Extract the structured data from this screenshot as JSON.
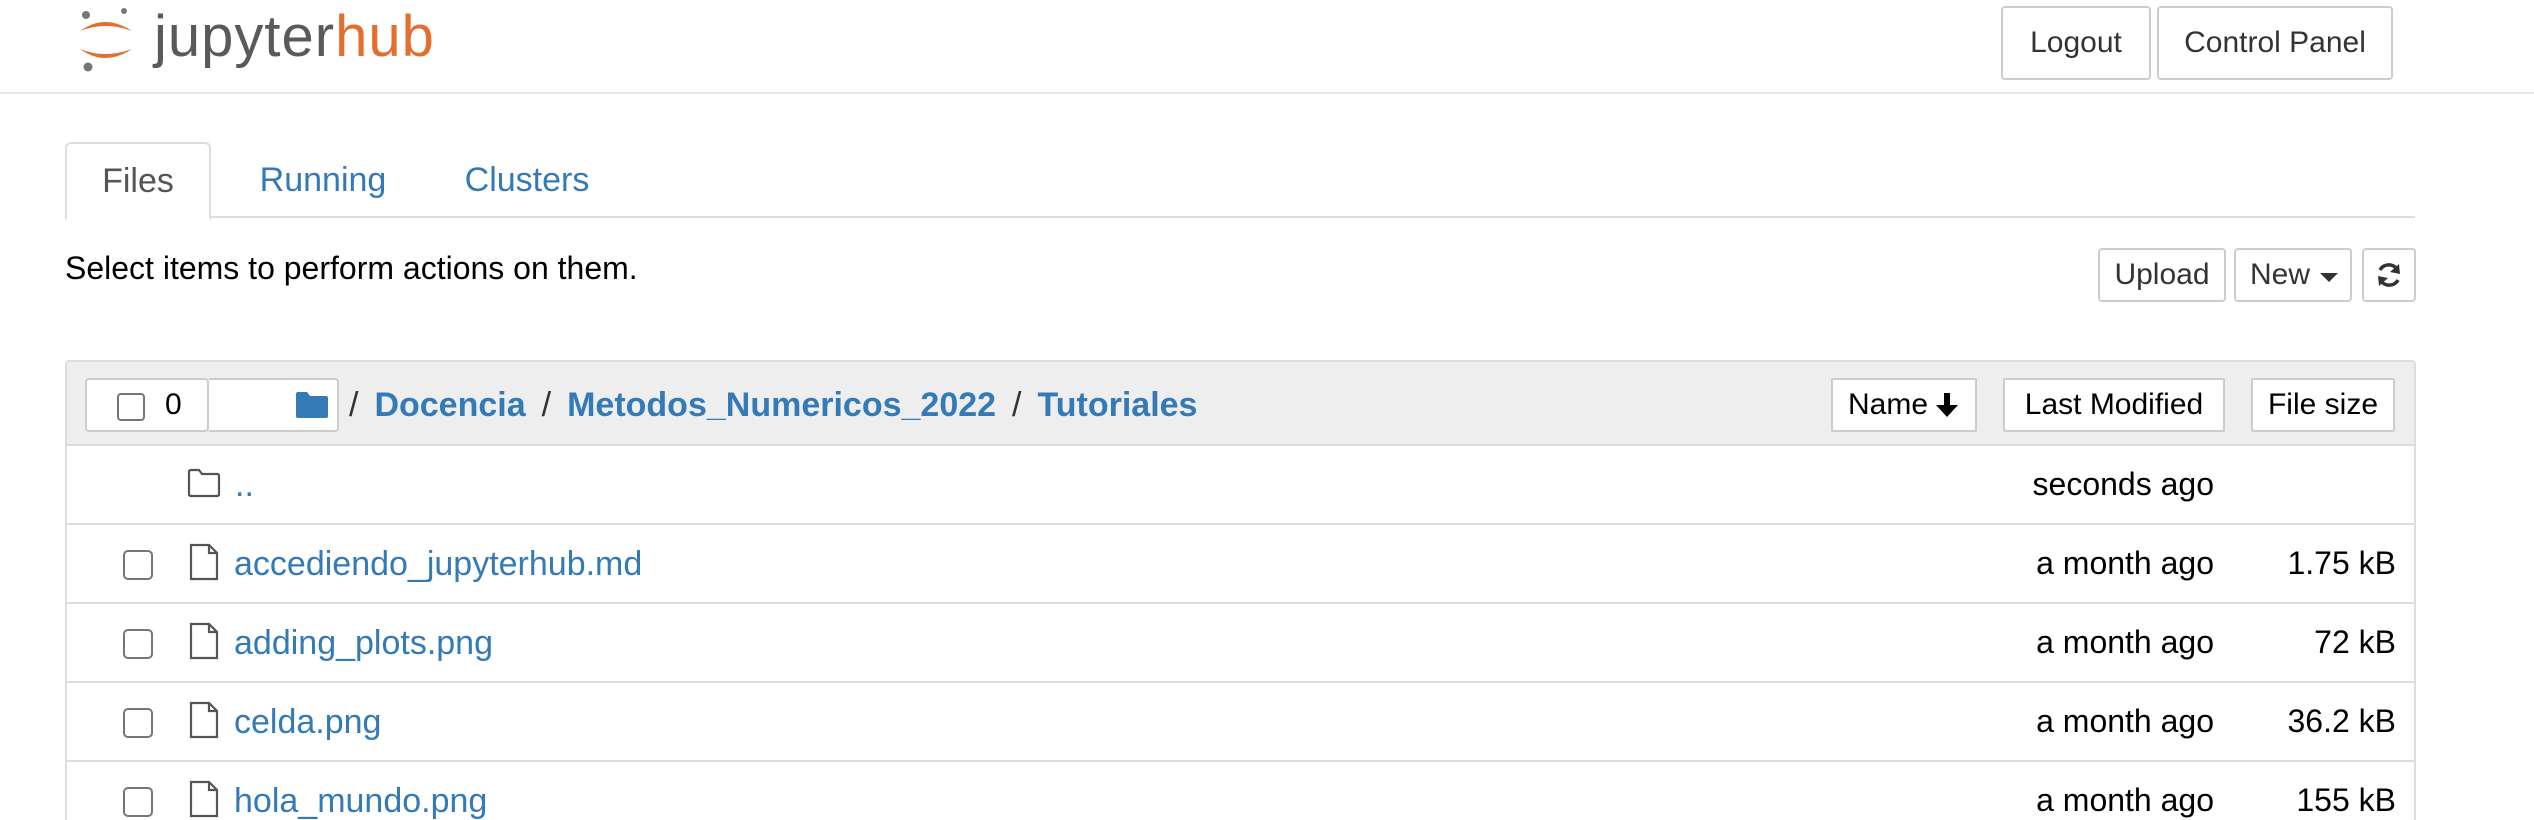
{
  "header": {
    "logo_text_jupyter": "jupyter",
    "logo_text_hub": "hub",
    "logout_label": "Logout",
    "control_panel_label": "Control Panel"
  },
  "tabs": [
    {
      "label": "Files",
      "active": true
    },
    {
      "label": "Running",
      "active": false
    },
    {
      "label": "Clusters",
      "active": false
    }
  ],
  "instructions": "Select items to perform actions on them.",
  "toolbar": {
    "upload_label": "Upload",
    "new_label": "New",
    "refresh_icon": "refresh-icon"
  },
  "list_header": {
    "selected_count": "0",
    "breadcrumb": [
      {
        "label": "Docencia"
      },
      {
        "label": "Metodos_Numericos_2022"
      },
      {
        "label": "Tutoriales"
      }
    ],
    "root_separator": "/",
    "sort_name_label": "Name",
    "sort_modified_label": "Last Modified",
    "sort_size_label": "File size"
  },
  "rows": [
    {
      "type": "folder",
      "name": "..",
      "modified": "seconds ago",
      "size": ""
    },
    {
      "type": "file",
      "name": "accediendo_jupyterhub.md",
      "modified": "a month ago",
      "size": "1.75 kB"
    },
    {
      "type": "file",
      "name": "adding_plots.png",
      "modified": "a month ago",
      "size": "72 kB"
    },
    {
      "type": "file",
      "name": "celda.png",
      "modified": "a month ago",
      "size": "36.2 kB"
    },
    {
      "type": "file",
      "name": "hola_mundo.png",
      "modified": "a month ago",
      "size": "155 kB"
    }
  ],
  "colors": {
    "link": "#337ab7",
    "brand_orange": "#e46e2e",
    "border": "#dddddd"
  }
}
